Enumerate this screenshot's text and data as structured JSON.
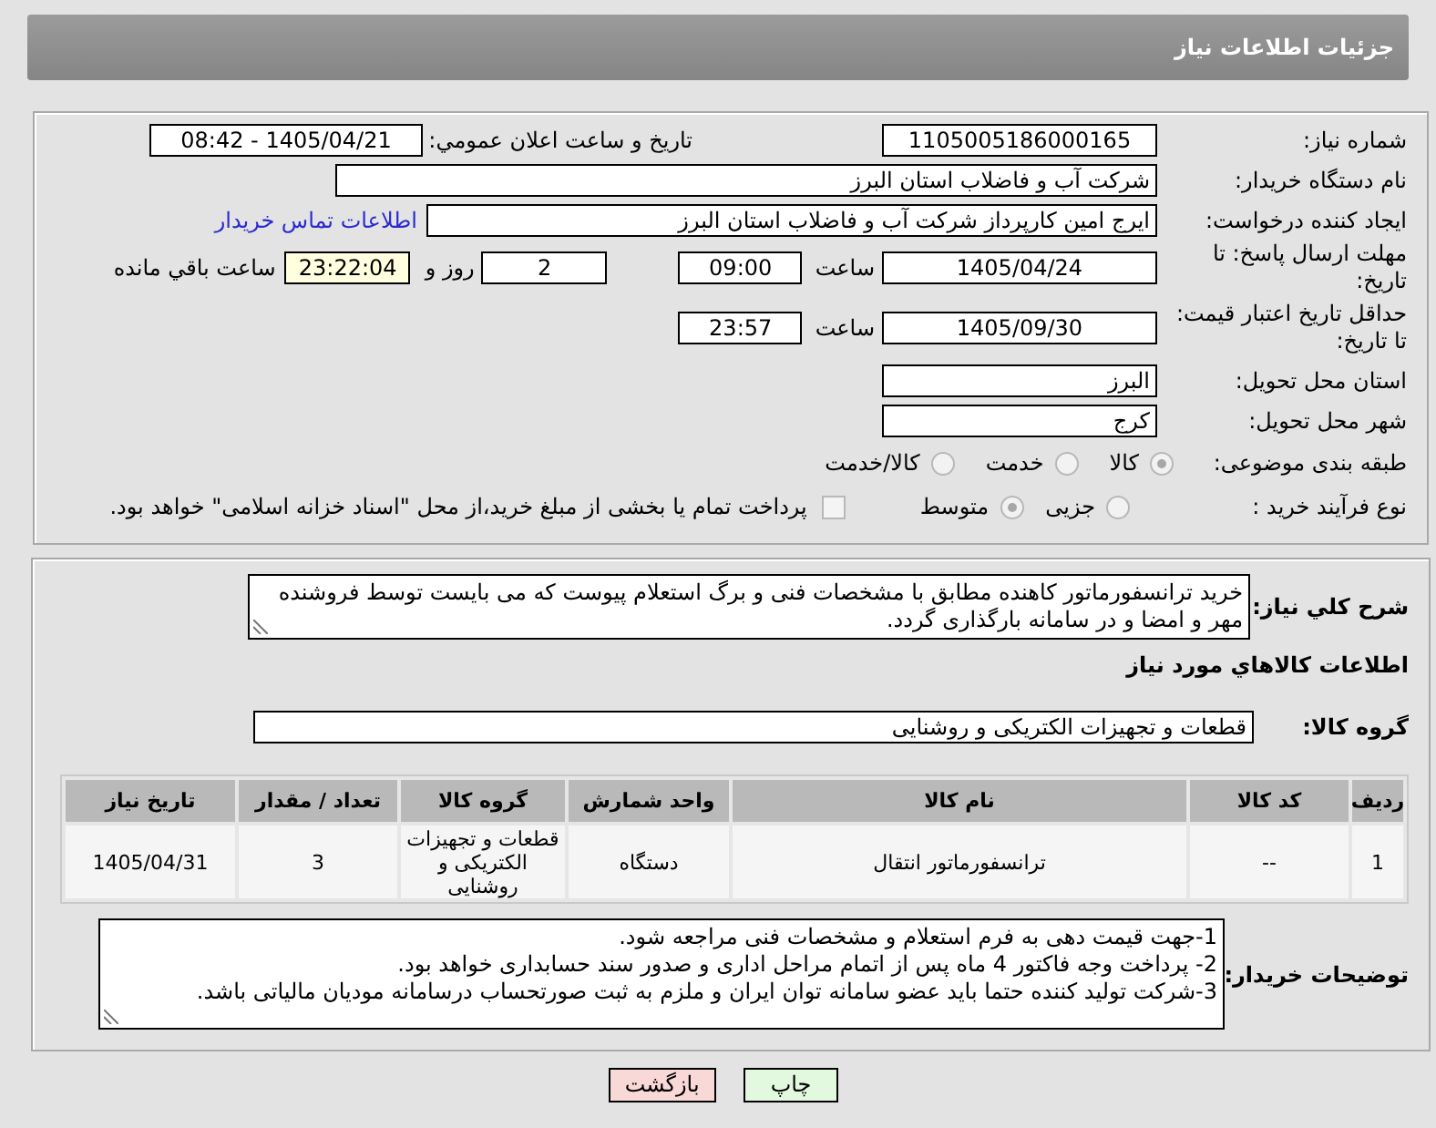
{
  "header": {
    "title": "جزئیات اطلاعات نیاز"
  },
  "details": {
    "need_number": {
      "label": "شماره نیاز:",
      "value": "1105005186000165"
    },
    "announcement": {
      "label": "تاریخ و ساعت اعلان عمومي:",
      "value": "1405/04/21 - 08:42"
    },
    "buyer_name": {
      "label": "نام دستگاه خریدار:",
      "value": "شرکت آب و فاضلاب استان البرز"
    },
    "requester": {
      "label": "ایجاد کننده درخواست:",
      "value": "ایرج امین کارپرداز شرکت آب و فاضلاب استان البرز",
      "contact_link": "اطلاعات تماس خریدار"
    },
    "response_deadline": {
      "label": "مهلت ارسال پاسخ: تا تاریخ:",
      "date": "1405/04/24",
      "time_label": "ساعت",
      "time": "09:00",
      "days": "2",
      "days_label": "روز و",
      "remaining": "23:22:04",
      "remaining_label": "ساعت باقي مانده"
    },
    "price_validity": {
      "label": "حداقل تاریخ اعتبار قیمت: تا تاریخ:",
      "date": "1405/09/30",
      "time_label": "ساعت",
      "time": "23:57"
    },
    "delivery_province": {
      "label": "استان محل تحویل:",
      "value": "البرز"
    },
    "delivery_city": {
      "label": "شهر محل تحویل:",
      "value": "کرج"
    },
    "subject_category": {
      "label": "طبقه بندی موضوعی:",
      "options": [
        {
          "label": "کالا",
          "selected": true
        },
        {
          "label": "خدمت",
          "selected": false
        },
        {
          "label": "کالا/خدمت",
          "selected": false
        }
      ]
    },
    "purchase_process": {
      "label": "نوع فرآیند خرید :",
      "options": [
        {
          "label": "جزیی",
          "selected": false
        },
        {
          "label": "متوسط",
          "selected": true
        }
      ],
      "treasury_payment": {
        "label": "پرداخت تمام یا بخشی از مبلغ خرید،از محل \"اسناد خزانه اسلامی\" خواهد بود.",
        "checked": false
      }
    }
  },
  "items": {
    "description": {
      "label": "شرح کلي نیاز:",
      "value": "خرید ترانسفورماتور کاهنده مطابق با مشخصات فنی و برگ استعلام پیوست که می بایست توسط فروشنده مهر و امضا و در سامانه بارگذاری گردد."
    },
    "section_title": "اطلاعات کالاهاي مورد نیاز",
    "goods_group": {
      "label": "گروه کالا:",
      "value": "قطعات و تجهیزات الکتریکی و روشنایی"
    },
    "table": {
      "columns": [
        "ردیف",
        "کد کالا",
        "نام کالا",
        "واحد شمارش",
        "گروه کالا",
        "تعداد / مقدار",
        "تاریخ نیاز"
      ],
      "rows": [
        {
          "cells": [
            "1",
            "--",
            "ترانسفورماتور انتقال",
            "دستگاه",
            "قطعات و تجهیزات الکتریکی و روشنایی",
            "3",
            "1405/04/31"
          ]
        }
      ]
    },
    "buyer_notes": {
      "label": "توضیحات خریدار:",
      "lines": [
        "1-جهت قیمت دهی به فرم استعلام و مشخصات فنی مراجعه شود.",
        "2- پرداخت وجه فاکتور 4 ماه پس از اتمام مراحل اداری و صدور سند حسابداری خواهد بود.",
        "3-شرکت تولید کننده حتما باید عضو سامانه توان ایران و ملزم به ثبت صورتحساب درسامانه مودیان مالیاتی باشد."
      ]
    }
  },
  "actions": {
    "buttons": [
      {
        "kind": "print",
        "label": "چاپ"
      },
      {
        "kind": "back",
        "label": "بازگشت"
      }
    ]
  }
}
